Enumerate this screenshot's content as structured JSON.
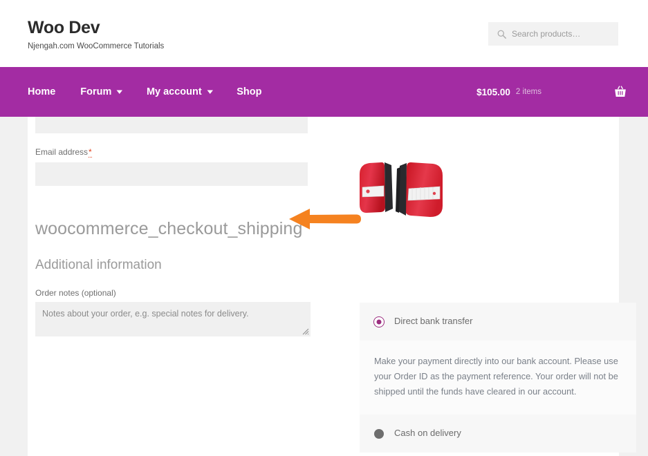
{
  "header": {
    "brand_title": "Woo Dev",
    "brand_tagline": "Njengah.com WooCommerce Tutorials",
    "search": {
      "placeholder": "Search products…",
      "value": "",
      "icon": "search-icon"
    }
  },
  "nav": {
    "items": [
      {
        "label": "Home",
        "has_caret": false
      },
      {
        "label": "Forum",
        "has_caret": true,
        "caret": "▾"
      },
      {
        "label": "My account",
        "has_caret": true,
        "caret": "▾"
      },
      {
        "label": "Shop",
        "has_caret": false
      }
    ],
    "cart": {
      "total": "$105.00",
      "items": "2 items",
      "icon": "shopping-basket-icon"
    },
    "background_color": "#a32ca3"
  },
  "checkout": {
    "email": {
      "label": "Email address",
      "required_mark": "*",
      "value": ""
    },
    "hook_heading": "woocommerce_checkout_shipping",
    "additional_information": {
      "heading": "Additional information",
      "notes_label": "Order notes (optional)",
      "notes_placeholder": "Notes about your order, e.g. special notes for delivery.",
      "notes_value": ""
    }
  },
  "product": {
    "alt": "pair of red car tail lights"
  },
  "payment": {
    "methods": [
      {
        "label": "Direct bank transfer",
        "selected": true,
        "description": "Make your payment directly into our bank account. Please use your Order ID as the payment reference. Your order will not be shipped until the funds have cleared in our account."
      },
      {
        "label": "Cash on delivery",
        "selected": false,
        "description": ""
      }
    ],
    "selected_color": "#9b2d7f",
    "unselected_color": "#6e6e6e"
  },
  "annotation": {
    "arrow_color": "#f58220",
    "points_to": "woocommerce_checkout_shipping"
  }
}
